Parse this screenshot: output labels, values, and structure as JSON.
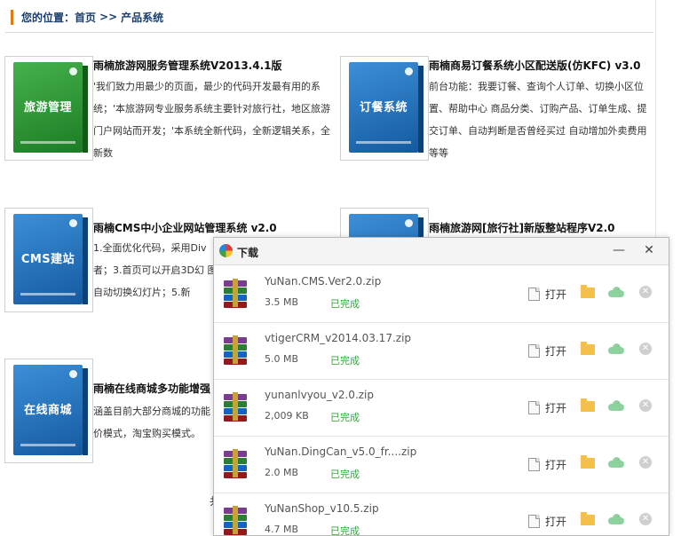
{
  "breadcrumb": {
    "prefix": "您的位置：",
    "home": "首页",
    "sep": ">>",
    "current": "产品系统"
  },
  "products": [
    {
      "box_label": "旅游管理",
      "title": "雨楠旅游网服务管理系统V2013.4.1版",
      "desc": "'我们致力用最少的页面，最少的代码开发最有用的系统；'本旅游网专业服务系统主要针对旅行社，地区旅游门户网站而开发；'本系统全新代码，全新逻辑关系，全新数"
    },
    {
      "box_label": "订餐系统",
      "title": "雨楠商易订餐系统小区配送版(仿KFC) v3.0",
      "desc": "前台功能：我要订餐、查询个人订单、切换小区位置、帮助中心 商品分类、订购产品、订单生成、提交订单、自动判断是否曾经买过 自动增加外卖费用等等"
    },
    {
      "box_label": "CMS建站",
      "title": "雨楠CMS中小企业网站管理系统 v2.0",
      "desc": "1.全面优化代码，采用Div 者；3.首页可以开启3D幻 图自动切换幻灯片；5.新"
    },
    {
      "box_label": "",
      "title": "雨楠旅游网[旅行社]新版整站程序V2.0",
      "desc": ""
    },
    {
      "box_label": "在线商城",
      "title": "雨楠在线商城多功能增强",
      "desc": "涵盖目前大部分商城的功能 价模式，淘宝购买模式。"
    }
  ],
  "paging": "共",
  "download": {
    "title": "下载",
    "minimize": "—",
    "close": "✕",
    "open_label": "打开",
    "items": [
      {
        "name": "YuNan.CMS.Ver2.0.zip",
        "size": "3.5 MB",
        "status": "已完成"
      },
      {
        "name": "vtigerCRM_v2014.03.17.zip",
        "size": "5.0 MB",
        "status": "已完成"
      },
      {
        "name": "yunanlvyou_v2.0.zip",
        "size": "2,009 KB",
        "status": "已完成"
      },
      {
        "name": "YuNan.DingCan_v5.0_fr....zip",
        "size": "2.0 MB",
        "status": "已完成"
      },
      {
        "name": "YuNanShop_v10.5.zip",
        "size": "4.7 MB",
        "status": "已完成"
      }
    ]
  },
  "colors": {
    "accent": "#e07b12",
    "link": "#1a3f6f",
    "done": "#3aa63a"
  }
}
